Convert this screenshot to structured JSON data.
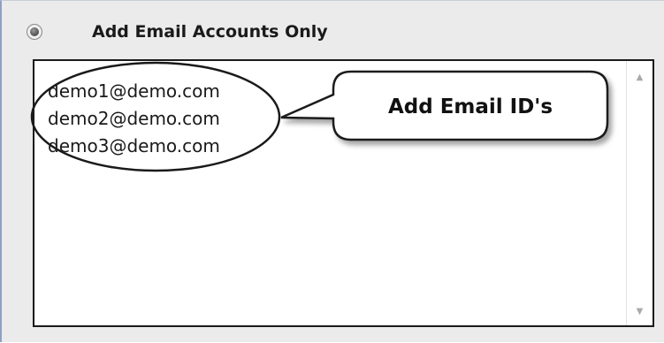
{
  "option": {
    "label": "Add Email Accounts Only",
    "selected": true
  },
  "emails": [
    "demo1@demo.com",
    "demo2@demo.com",
    "demo3@demo.com"
  ],
  "callout": {
    "text": "Add Email ID's"
  },
  "scrollbar": {
    "up_icon": "chevron-up-icon",
    "down_icon": "chevron-down-icon"
  },
  "colors": {
    "panel_background": "#ebebeb",
    "panel_border": "#8ea0c4",
    "text": "#1a1a1a"
  }
}
